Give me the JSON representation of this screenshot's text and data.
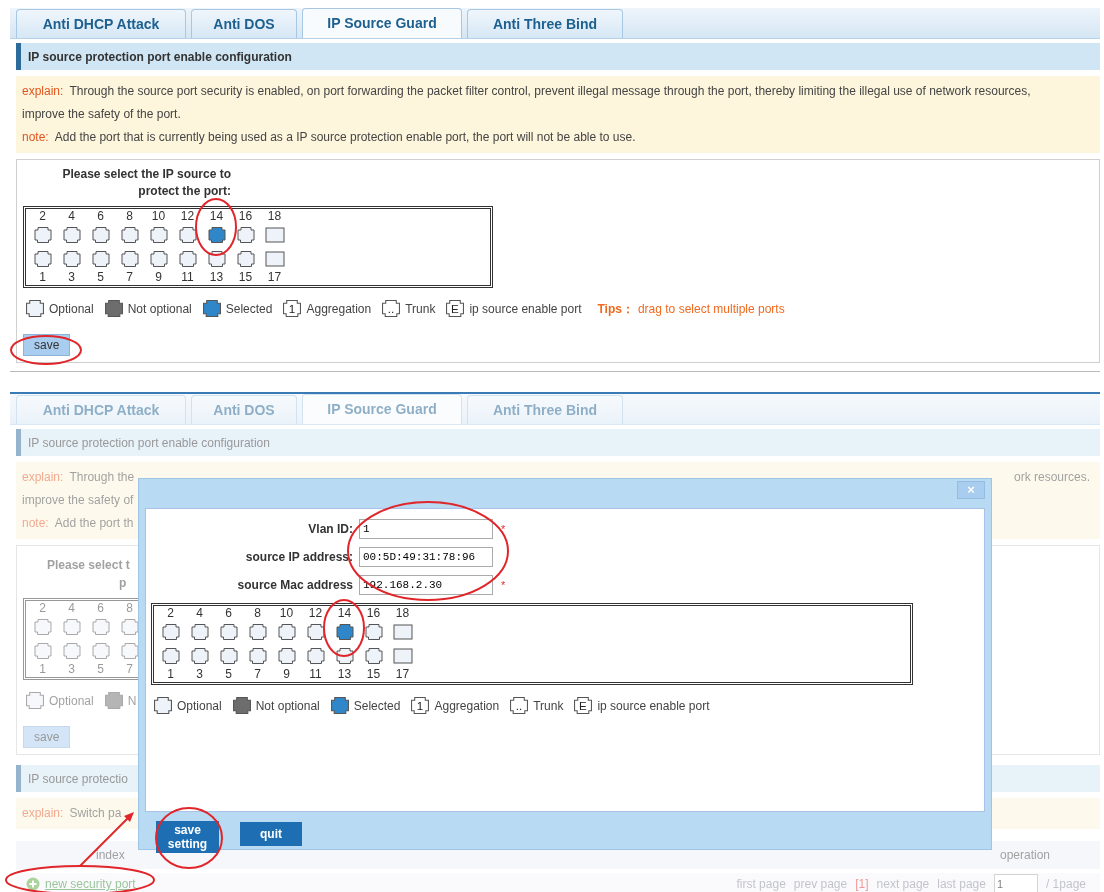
{
  "top_screen": {
    "tabs": [
      {
        "label": "Anti DHCP Attack",
        "selected": false
      },
      {
        "label": "Anti DOS",
        "selected": false
      },
      {
        "label": "IP Source Guard",
        "selected": true
      },
      {
        "label": "Anti Three Bind",
        "selected": false
      }
    ],
    "section_title": "IP source protection port enable configuration",
    "explain": {
      "label": "explain:",
      "text": "Through the source port security is enabled, on port forwarding the packet filter control, prevent illegal message through the port, thereby limiting the illegal use of network resources, improve the safety of the port."
    },
    "note": {
      "label": "note:",
      "text": "Add the port that is currently being used as a IP source protection enable port, the port will not be able to use."
    },
    "port_selector": {
      "title": "Please select the IP source to protect the port:",
      "top_row": [
        {
          "number": "2",
          "kind": "copper",
          "selected": false
        },
        {
          "number": "4",
          "kind": "copper",
          "selected": false
        },
        {
          "number": "6",
          "kind": "copper",
          "selected": false
        },
        {
          "number": "8",
          "kind": "copper",
          "selected": false
        },
        {
          "number": "10",
          "kind": "copper",
          "selected": false
        },
        {
          "number": "12",
          "kind": "copper",
          "selected": false
        },
        {
          "number": "14",
          "kind": "copper",
          "selected": true
        },
        {
          "number": "16",
          "kind": "copper",
          "selected": false
        },
        {
          "number": "18",
          "kind": "fiber",
          "selected": false
        }
      ],
      "bottom_row": [
        {
          "number": "1",
          "kind": "copper",
          "selected": false
        },
        {
          "number": "3",
          "kind": "copper",
          "selected": false
        },
        {
          "number": "5",
          "kind": "copper",
          "selected": false
        },
        {
          "number": "7",
          "kind": "copper",
          "selected": false
        },
        {
          "number": "9",
          "kind": "copper",
          "selected": false
        },
        {
          "number": "11",
          "kind": "copper",
          "selected": false
        },
        {
          "number": "13",
          "kind": "copper",
          "selected": false
        },
        {
          "number": "15",
          "kind": "copper",
          "selected": false
        },
        {
          "number": "17",
          "kind": "fiber",
          "selected": false
        }
      ]
    },
    "legend": [
      {
        "kind": "optional",
        "label": "Optional"
      },
      {
        "kind": "not_optional",
        "label": "Not optional"
      },
      {
        "kind": "selected",
        "label": "Selected"
      },
      {
        "kind": "aggregation",
        "glyph": "1",
        "label": "Aggregation"
      },
      {
        "kind": "trunk",
        "glyph": "..",
        "label": "Trunk"
      },
      {
        "kind": "ip_source",
        "glyph": "E",
        "label": "ip source enable port"
      }
    ],
    "tips": {
      "label": "Tips：",
      "text": "drag to select multiple ports"
    },
    "save_button": "save"
  },
  "bottom_screen": {
    "tabs": [
      {
        "label": "Anti DHCP Attack",
        "selected": false
      },
      {
        "label": "Anti DOS",
        "selected": false
      },
      {
        "label": "IP Source Guard",
        "selected": true
      },
      {
        "label": "Anti Three Bind",
        "selected": false
      }
    ],
    "section_title": "IP source protection port enable configuration",
    "explain": {
      "label": "explain:",
      "text": "Through the",
      "tail": "ork resources."
    },
    "explain_line_2": "improve the safety of",
    "note": {
      "label": "note:",
      "text": "Add the port th"
    },
    "port_selector": {
      "title_fragments": [
        "Please select t",
        "p"
      ],
      "top_row": [
        {
          "number": "2",
          "kind": "copper",
          "selected": false
        },
        {
          "number": "4",
          "kind": "copper",
          "selected": false
        },
        {
          "number": "6",
          "kind": "copper",
          "selected": false
        },
        {
          "number": "8",
          "kind": "copper",
          "selected": false
        }
      ],
      "bottom_row": [
        {
          "number": "1",
          "kind": "copper",
          "selected": false
        },
        {
          "number": "3",
          "kind": "copper",
          "selected": false
        },
        {
          "number": "5",
          "kind": "copper",
          "selected": false
        },
        {
          "number": "7",
          "kind": "copper",
          "selected": false
        }
      ]
    },
    "legend": [
      {
        "kind": "optional",
        "label": "Optional"
      },
      {
        "kind": "not_optional",
        "label": "N"
      }
    ],
    "save_button": "save",
    "section_title_2": "IP source protectio",
    "explain_2": {
      "label": "explain:",
      "text": "Switch pa"
    },
    "table": {
      "columns": [
        "index",
        "operation"
      ]
    },
    "add_link": "new security port",
    "pagination": {
      "first": "first page",
      "prev": "prev page",
      "current": "[1]",
      "next": "next page",
      "last": "last page",
      "page_input": "1",
      "total": "/ 1page"
    },
    "dialog": {
      "close": "×",
      "required_mark": "*",
      "fields": [
        {
          "label": "Vlan ID:",
          "value": "1",
          "required": true
        },
        {
          "label": "source IP address:",
          "value": "00:5D:49:31:78:96",
          "required": false
        },
        {
          "label": "source Mac address",
          "value": "192.168.2.30",
          "required": true
        }
      ],
      "port_selector": {
        "top_row": [
          {
            "number": "2",
            "kind": "copper",
            "selected": false
          },
          {
            "number": "4",
            "kind": "copper",
            "selected": false
          },
          {
            "number": "6",
            "kind": "copper",
            "selected": false
          },
          {
            "number": "8",
            "kind": "copper",
            "selected": false
          },
          {
            "number": "10",
            "kind": "copper",
            "selected": false
          },
          {
            "number": "12",
            "kind": "copper",
            "selected": false
          },
          {
            "number": "14",
            "kind": "copper",
            "selected": true
          },
          {
            "number": "16",
            "kind": "copper",
            "selected": false
          },
          {
            "number": "18",
            "kind": "fiber",
            "selected": false
          }
        ],
        "bottom_row": [
          {
            "number": "1",
            "kind": "copper",
            "selected": false
          },
          {
            "number": "3",
            "kind": "copper",
            "selected": false
          },
          {
            "number": "5",
            "kind": "copper",
            "selected": false
          },
          {
            "number": "7",
            "kind": "copper",
            "selected": false
          },
          {
            "number": "9",
            "kind": "copper",
            "selected": false
          },
          {
            "number": "11",
            "kind": "copper",
            "selected": false
          },
          {
            "number": "13",
            "kind": "copper",
            "selected": false
          },
          {
            "number": "15",
            "kind": "copper",
            "selected": false
          },
          {
            "number": "17",
            "kind": "fiber",
            "selected": false
          }
        ]
      },
      "legend": [
        {
          "kind": "optional",
          "label": "Optional"
        },
        {
          "kind": "not_optional",
          "label": "Not optional"
        },
        {
          "kind": "selected",
          "label": "Selected"
        },
        {
          "kind": "aggregation",
          "glyph": "1",
          "label": "Aggregation"
        },
        {
          "kind": "trunk",
          "glyph": "..",
          "label": "Trunk"
        },
        {
          "kind": "ip_source",
          "glyph": "E",
          "label": "ip source enable port"
        }
      ],
      "buttons": [
        "save setting",
        "quit"
      ]
    }
  }
}
